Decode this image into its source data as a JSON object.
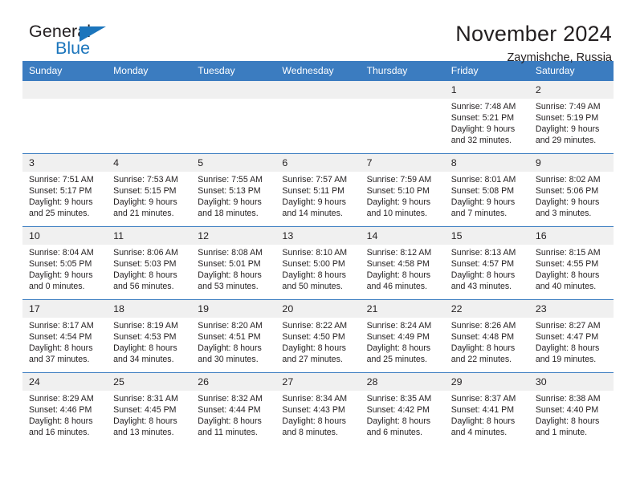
{
  "logo": {
    "word_one": "General",
    "word_two": "Blue",
    "triangle_color": "#1b75bc",
    "triangle_icon": "triangle-icon"
  },
  "header": {
    "month_title": "November 2024",
    "location": "Zaymishche, Russia"
  },
  "theme": {
    "header_blue": "#3b7cc0",
    "daynum_gray": "#f0f0f0",
    "text": "#231f20",
    "logo_blue": "#1b75bc"
  },
  "weekdays": [
    "Sunday",
    "Monday",
    "Tuesday",
    "Wednesday",
    "Thursday",
    "Friday",
    "Saturday"
  ],
  "weeks": [
    [
      {
        "day": "",
        "blank": true
      },
      {
        "day": "",
        "blank": true
      },
      {
        "day": "",
        "blank": true
      },
      {
        "day": "",
        "blank": true
      },
      {
        "day": "",
        "blank": true
      },
      {
        "day": "1",
        "sunrise": "Sunrise: 7:48 AM",
        "sunset": "Sunset: 5:21 PM",
        "daylight1": "Daylight: 9 hours",
        "daylight2": "and 32 minutes."
      },
      {
        "day": "2",
        "sunrise": "Sunrise: 7:49 AM",
        "sunset": "Sunset: 5:19 PM",
        "daylight1": "Daylight: 9 hours",
        "daylight2": "and 29 minutes."
      }
    ],
    [
      {
        "day": "3",
        "sunrise": "Sunrise: 7:51 AM",
        "sunset": "Sunset: 5:17 PM",
        "daylight1": "Daylight: 9 hours",
        "daylight2": "and 25 minutes."
      },
      {
        "day": "4",
        "sunrise": "Sunrise: 7:53 AM",
        "sunset": "Sunset: 5:15 PM",
        "daylight1": "Daylight: 9 hours",
        "daylight2": "and 21 minutes."
      },
      {
        "day": "5",
        "sunrise": "Sunrise: 7:55 AM",
        "sunset": "Sunset: 5:13 PM",
        "daylight1": "Daylight: 9 hours",
        "daylight2": "and 18 minutes."
      },
      {
        "day": "6",
        "sunrise": "Sunrise: 7:57 AM",
        "sunset": "Sunset: 5:11 PM",
        "daylight1": "Daylight: 9 hours",
        "daylight2": "and 14 minutes."
      },
      {
        "day": "7",
        "sunrise": "Sunrise: 7:59 AM",
        "sunset": "Sunset: 5:10 PM",
        "daylight1": "Daylight: 9 hours",
        "daylight2": "and 10 minutes."
      },
      {
        "day": "8",
        "sunrise": "Sunrise: 8:01 AM",
        "sunset": "Sunset: 5:08 PM",
        "daylight1": "Daylight: 9 hours",
        "daylight2": "and 7 minutes."
      },
      {
        "day": "9",
        "sunrise": "Sunrise: 8:02 AM",
        "sunset": "Sunset: 5:06 PM",
        "daylight1": "Daylight: 9 hours",
        "daylight2": "and 3 minutes."
      }
    ],
    [
      {
        "day": "10",
        "sunrise": "Sunrise: 8:04 AM",
        "sunset": "Sunset: 5:05 PM",
        "daylight1": "Daylight: 9 hours",
        "daylight2": "and 0 minutes."
      },
      {
        "day": "11",
        "sunrise": "Sunrise: 8:06 AM",
        "sunset": "Sunset: 5:03 PM",
        "daylight1": "Daylight: 8 hours",
        "daylight2": "and 56 minutes."
      },
      {
        "day": "12",
        "sunrise": "Sunrise: 8:08 AM",
        "sunset": "Sunset: 5:01 PM",
        "daylight1": "Daylight: 8 hours",
        "daylight2": "and 53 minutes."
      },
      {
        "day": "13",
        "sunrise": "Sunrise: 8:10 AM",
        "sunset": "Sunset: 5:00 PM",
        "daylight1": "Daylight: 8 hours",
        "daylight2": "and 50 minutes."
      },
      {
        "day": "14",
        "sunrise": "Sunrise: 8:12 AM",
        "sunset": "Sunset: 4:58 PM",
        "daylight1": "Daylight: 8 hours",
        "daylight2": "and 46 minutes."
      },
      {
        "day": "15",
        "sunrise": "Sunrise: 8:13 AM",
        "sunset": "Sunset: 4:57 PM",
        "daylight1": "Daylight: 8 hours",
        "daylight2": "and 43 minutes."
      },
      {
        "day": "16",
        "sunrise": "Sunrise: 8:15 AM",
        "sunset": "Sunset: 4:55 PM",
        "daylight1": "Daylight: 8 hours",
        "daylight2": "and 40 minutes."
      }
    ],
    [
      {
        "day": "17",
        "sunrise": "Sunrise: 8:17 AM",
        "sunset": "Sunset: 4:54 PM",
        "daylight1": "Daylight: 8 hours",
        "daylight2": "and 37 minutes."
      },
      {
        "day": "18",
        "sunrise": "Sunrise: 8:19 AM",
        "sunset": "Sunset: 4:53 PM",
        "daylight1": "Daylight: 8 hours",
        "daylight2": "and 34 minutes."
      },
      {
        "day": "19",
        "sunrise": "Sunrise: 8:20 AM",
        "sunset": "Sunset: 4:51 PM",
        "daylight1": "Daylight: 8 hours",
        "daylight2": "and 30 minutes."
      },
      {
        "day": "20",
        "sunrise": "Sunrise: 8:22 AM",
        "sunset": "Sunset: 4:50 PM",
        "daylight1": "Daylight: 8 hours",
        "daylight2": "and 27 minutes."
      },
      {
        "day": "21",
        "sunrise": "Sunrise: 8:24 AM",
        "sunset": "Sunset: 4:49 PM",
        "daylight1": "Daylight: 8 hours",
        "daylight2": "and 25 minutes."
      },
      {
        "day": "22",
        "sunrise": "Sunrise: 8:26 AM",
        "sunset": "Sunset: 4:48 PM",
        "daylight1": "Daylight: 8 hours",
        "daylight2": "and 22 minutes."
      },
      {
        "day": "23",
        "sunrise": "Sunrise: 8:27 AM",
        "sunset": "Sunset: 4:47 PM",
        "daylight1": "Daylight: 8 hours",
        "daylight2": "and 19 minutes."
      }
    ],
    [
      {
        "day": "24",
        "sunrise": "Sunrise: 8:29 AM",
        "sunset": "Sunset: 4:46 PM",
        "daylight1": "Daylight: 8 hours",
        "daylight2": "and 16 minutes."
      },
      {
        "day": "25",
        "sunrise": "Sunrise: 8:31 AM",
        "sunset": "Sunset: 4:45 PM",
        "daylight1": "Daylight: 8 hours",
        "daylight2": "and 13 minutes."
      },
      {
        "day": "26",
        "sunrise": "Sunrise: 8:32 AM",
        "sunset": "Sunset: 4:44 PM",
        "daylight1": "Daylight: 8 hours",
        "daylight2": "and 11 minutes."
      },
      {
        "day": "27",
        "sunrise": "Sunrise: 8:34 AM",
        "sunset": "Sunset: 4:43 PM",
        "daylight1": "Daylight: 8 hours",
        "daylight2": "and 8 minutes."
      },
      {
        "day": "28",
        "sunrise": "Sunrise: 8:35 AM",
        "sunset": "Sunset: 4:42 PM",
        "daylight1": "Daylight: 8 hours",
        "daylight2": "and 6 minutes."
      },
      {
        "day": "29",
        "sunrise": "Sunrise: 8:37 AM",
        "sunset": "Sunset: 4:41 PM",
        "daylight1": "Daylight: 8 hours",
        "daylight2": "and 4 minutes."
      },
      {
        "day": "30",
        "sunrise": "Sunrise: 8:38 AM",
        "sunset": "Sunset: 4:40 PM",
        "daylight1": "Daylight: 8 hours",
        "daylight2": "and 1 minute."
      }
    ]
  ]
}
